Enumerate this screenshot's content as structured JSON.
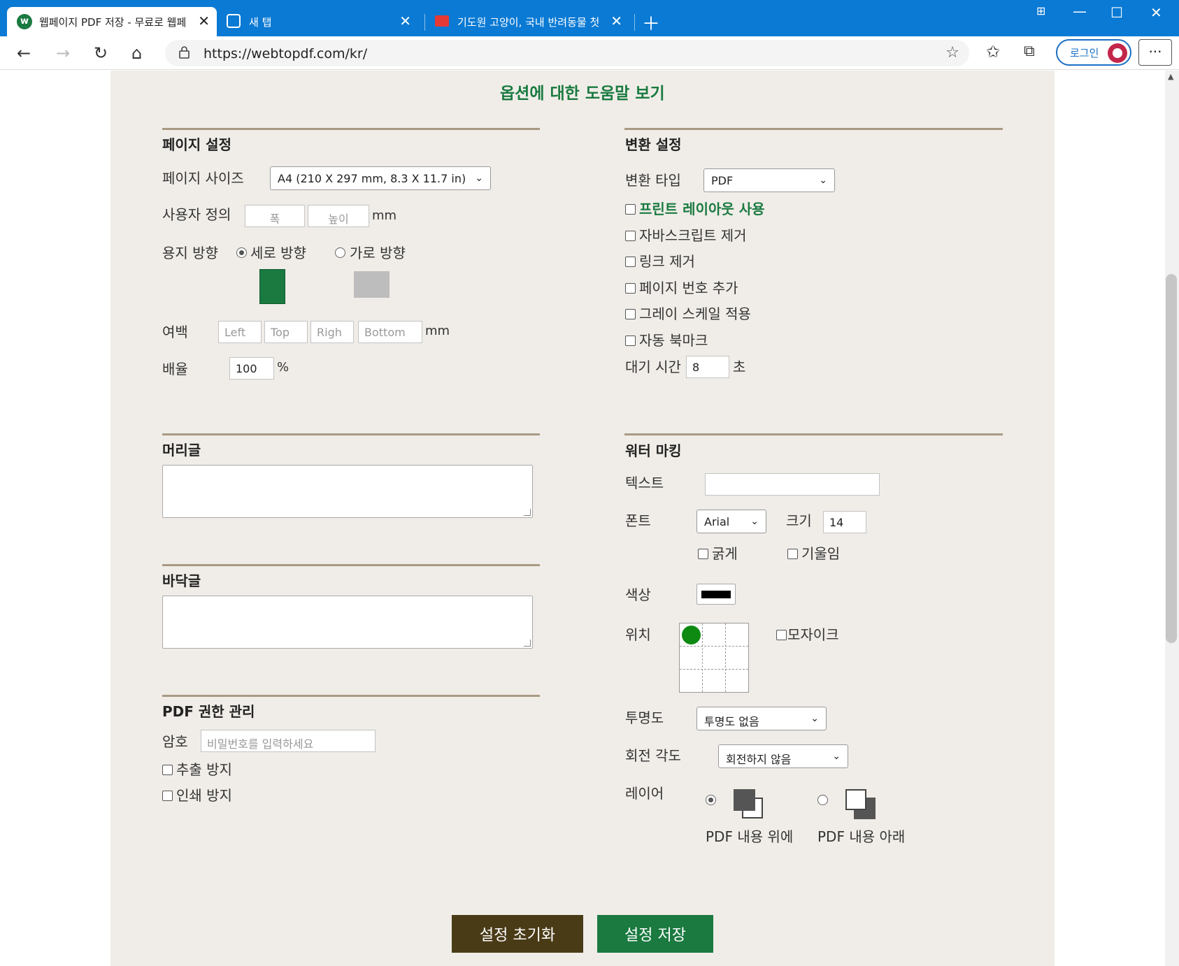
{
  "browser": {
    "tabs": [
      {
        "title": "웹페이지 PDF 저장 - 무료로 웹페",
        "icon": "webtopdf-favicon"
      },
      {
        "title": "새 탭",
        "icon": "new-tab-icon"
      },
      {
        "title": "기도원 고양이, 국내 반려동물 첫",
        "icon": "news-favicon"
      }
    ],
    "url": "https://webtopdf.com/kr/",
    "login_label": "로그인"
  },
  "page": {
    "help_link": "옵션에 대한 도움말 보기",
    "page_settings": {
      "title": "페이지 설정",
      "page_size_label": "페이지 사이즈",
      "page_size_value": "A4 (210 X 297 mm, 8.3 X 11.7 in)",
      "custom_label": "사용자 정의",
      "width_placeholder": "폭",
      "height_placeholder": "높이",
      "unit_mm": "mm",
      "orientation_label": "용지 방향",
      "portrait_label": "세로 방향",
      "landscape_label": "가로 방향",
      "margin_label": "여백",
      "margin_left": "Left",
      "margin_top": "Top",
      "margin_right": "Righ",
      "margin_bottom": "Bottom",
      "margin_unit": "mm",
      "scale_label": "배율",
      "scale_value": "100",
      "scale_unit": "%"
    },
    "conversion": {
      "title": "변환 설정",
      "type_label": "변환 타입",
      "type_value": "PDF",
      "print_layout": "프린트 레이아웃 사용",
      "remove_js": "자바스크립트 제거",
      "remove_links": "링크 제거",
      "page_numbers": "페이지 번호 추가",
      "grayscale": "그레이 스케일 적용",
      "auto_bookmark": "자동 북마크",
      "wait_label": "대기 시간",
      "wait_value": "8",
      "wait_unit": "초"
    },
    "header": {
      "title": "머리글"
    },
    "footer": {
      "title": "바닥글"
    },
    "permissions": {
      "title": "PDF 권한 관리",
      "password_label": "암호",
      "password_placeholder": "비밀번호를 입력하세요",
      "no_extract": "추출 방지",
      "no_print": "인쇄 방지"
    },
    "watermark": {
      "title": "워터 마킹",
      "text_label": "텍스트",
      "font_label": "폰트",
      "font_value": "Arial",
      "size_label": "크기",
      "size_value": "14",
      "bold": "굵게",
      "italic": "기울임",
      "color_label": "색상",
      "position_label": "위치",
      "mosaic": "모자이크",
      "opacity_label": "투명도",
      "opacity_value": "투명도 없음",
      "rotation_label": "회전 각도",
      "rotation_value": "회전하지 않음",
      "layer_label": "레이어",
      "layer_over": "PDF 내용 위에",
      "layer_under": "PDF 내용 아래"
    },
    "buttons": {
      "reset": "설정 초기화",
      "save": "설정 저장"
    },
    "colors": {
      "green": "#1a7a40",
      "brown": "#4a3b17",
      "panel": "#f0ede8",
      "rule": "#a99a84"
    }
  }
}
